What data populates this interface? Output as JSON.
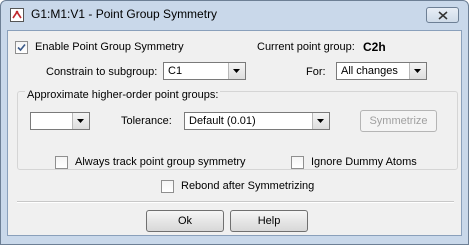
{
  "window": {
    "title": "G1:M1:V1 - Point Group Symmetry"
  },
  "enable_symmetry": {
    "label": "Enable Point Group Symmetry",
    "checked": true
  },
  "current_point_group": {
    "label": "Current point group:",
    "value": "C2h"
  },
  "constrain": {
    "label": "Constrain to subgroup:",
    "value": "C1"
  },
  "for_field": {
    "label": "For:",
    "value": "All changes"
  },
  "approx_group": {
    "legend": "Approximate higher-order point groups:",
    "group_select_value": "",
    "tolerance_label": "Tolerance:",
    "tolerance_value": "Default (0.01)",
    "symmetrize_label": "Symmetrize"
  },
  "options": {
    "always_track": {
      "label": "Always track point group symmetry",
      "checked": false
    },
    "ignore_dummy": {
      "label": "Ignore Dummy Atoms",
      "checked": false
    },
    "rebond": {
      "label": "Rebond after Symmetrizing",
      "checked": false
    }
  },
  "buttons": {
    "ok": "Ok",
    "help": "Help"
  }
}
